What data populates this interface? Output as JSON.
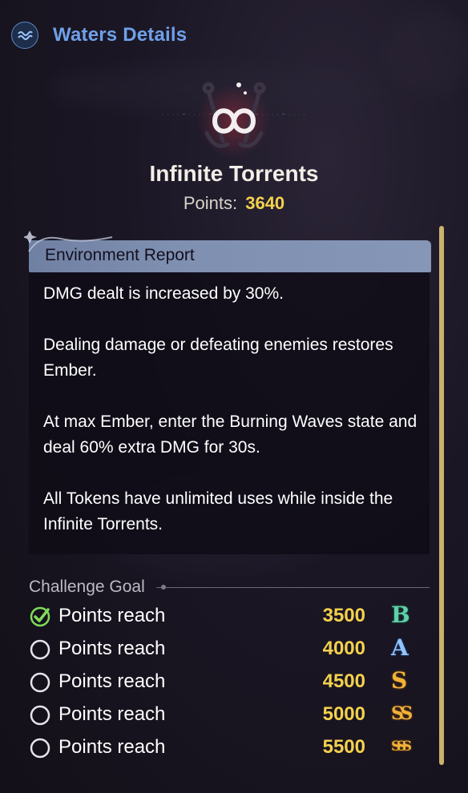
{
  "header": {
    "title": "Waters Details",
    "icon": "waves-icon"
  },
  "emblem": {
    "icon": "anchor-infinity-emblem-icon"
  },
  "mode": {
    "name": "Infinite Torrents",
    "points_label": "Points:",
    "points_value": "3640"
  },
  "environment_report": {
    "title": "Environment Report",
    "paragraphs": [
      "DMG dealt is increased by 30%.",
      "Dealing damage or defeating enemies restores Ember.",
      "At max Ember, enter the Burning Waves state and deal 60% extra DMG for 30s.",
      "All Tokens have unlimited uses while inside the Infinite Torrents."
    ]
  },
  "challenge": {
    "title": "Challenge Goal",
    "goals": [
      {
        "label": "Points reach",
        "value": "3500",
        "rank": "B",
        "completed": true
      },
      {
        "label": "Points reach",
        "value": "4000",
        "rank": "A",
        "completed": false
      },
      {
        "label": "Points reach",
        "value": "4500",
        "rank": "S",
        "completed": false
      },
      {
        "label": "Points reach",
        "value": "5000",
        "rank": "SS",
        "completed": false
      },
      {
        "label": "Points reach",
        "value": "5500",
        "rank": "SSS",
        "completed": false
      }
    ]
  },
  "colors": {
    "accent_blue": "#6fa0e8",
    "points_gold": "#f4d14d",
    "check_green": "#7fdc5a",
    "scrollbar": "#c9b26c"
  }
}
